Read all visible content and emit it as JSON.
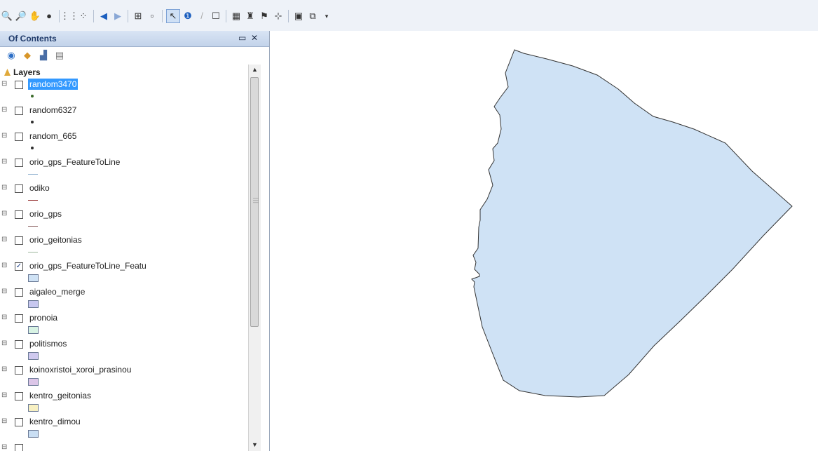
{
  "toolbar": {
    "icons": [
      "zoom-out-icon",
      "zoom-in-icon",
      "pan-icon",
      "full-extent-icon",
      "fixed-zoom-in-icon",
      "fixed-zoom-out-icon",
      "back-extent-icon",
      "forward-extent-icon",
      "select-features-icon",
      "clear-selection-icon",
      "select-elements-icon",
      "identify-icon",
      "edit-pencil-icon",
      "html-popup-icon",
      "measure-icon",
      "find-binoculars-icon",
      "find-route-icon",
      "go-to-xy-icon",
      "create-viewer-icon",
      "toolbar-options-icon"
    ]
  },
  "toc": {
    "title": "Of Contents",
    "root_label": "Layers",
    "tool_icons": [
      "list-by-drawing-order-icon",
      "list-by-source-icon",
      "list-by-visibility-icon",
      "list-by-selection-icon"
    ]
  },
  "layers": [
    {
      "name": "random3470",
      "checked": false,
      "selected": true,
      "symbol": "point",
      "color": "#3a6b2a"
    },
    {
      "name": "random6327",
      "checked": false,
      "selected": false,
      "symbol": "point",
      "color": "#2d2d2d"
    },
    {
      "name": "random_665",
      "checked": false,
      "selected": false,
      "symbol": "point",
      "color": "#2d2d2d"
    },
    {
      "name": "orio_gps_FeatureToLine",
      "checked": false,
      "selected": false,
      "symbol": "line",
      "color": "#8fb0cf"
    },
    {
      "name": "odiko",
      "checked": false,
      "selected": false,
      "symbol": "line",
      "color": "#8b1a1a"
    },
    {
      "name": "orio_gps",
      "checked": false,
      "selected": false,
      "symbol": "line",
      "color": "#7f4f4f"
    },
    {
      "name": "orio_geitonias",
      "checked": false,
      "selected": false,
      "symbol": "line",
      "color": "#9eb89e"
    },
    {
      "name": "orio_gps_FeatureToLine_Featu",
      "checked": true,
      "selected": false,
      "symbol": "polygon",
      "color": "#cfe2f5"
    },
    {
      "name": "aigaleo_merge",
      "checked": false,
      "selected": false,
      "symbol": "polygon",
      "color": "#c7c7ef"
    },
    {
      "name": "pronoia",
      "checked": false,
      "selected": false,
      "symbol": "polygon",
      "color": "#d8f3e4"
    },
    {
      "name": "politismos",
      "checked": false,
      "selected": false,
      "symbol": "polygon",
      "color": "#cfc9ef"
    },
    {
      "name": "koinoxristoi_xoroi_prasinou",
      "checked": false,
      "selected": false,
      "symbol": "polygon",
      "color": "#dcc6e8"
    },
    {
      "name": "kentro_geitonias",
      "checked": false,
      "selected": false,
      "symbol": "polygon",
      "color": "#f7f0c2"
    },
    {
      "name": "kentro_dimou",
      "checked": false,
      "selected": false,
      "symbol": "polygon",
      "color": "#c9def3"
    },
    {
      "name": "",
      "checked": false,
      "selected": false,
      "symbol": "polygon",
      "color": "#9cc5e8"
    }
  ],
  "map": {
    "fill": "#cfe2f5",
    "stroke": "#333333"
  }
}
